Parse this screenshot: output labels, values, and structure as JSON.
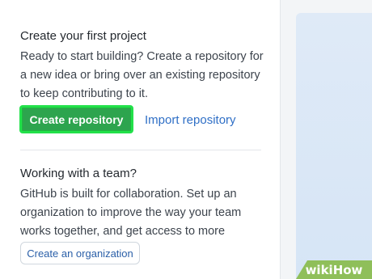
{
  "first_project": {
    "title": "Create your first project",
    "body": "Ready to start building? Create a repository for a new idea or bring over an existing repository to keep contributing to it.",
    "create_button": "Create repository",
    "import_link": "Import repository"
  },
  "team": {
    "title": "Working with a team?",
    "body": "GitHub is built for collaboration. Set up an organization to improve the way your team works together, and get access to more features.",
    "org_button": "Create an organization"
  },
  "watermark": "wikiHow",
  "colors": {
    "primary_button": "#2da44e",
    "highlight_border": "#22e14a",
    "link": "#2f6fc6",
    "watermark_bg": "#8fbf5a"
  }
}
